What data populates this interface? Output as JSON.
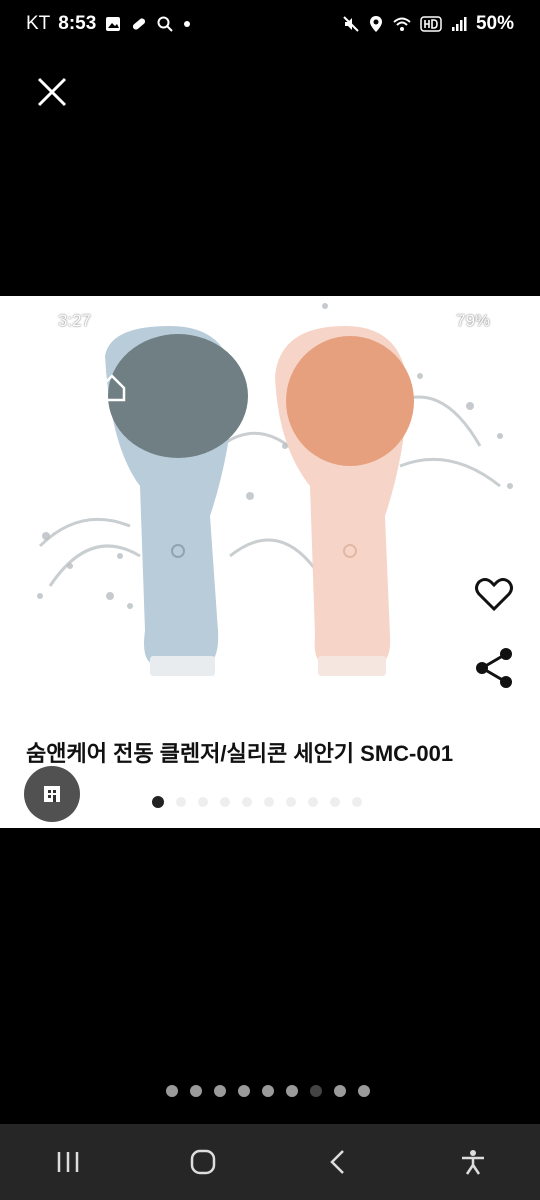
{
  "status_bar": {
    "carrier": "KT",
    "time": "8:53",
    "battery": "50%",
    "icons_left": [
      "gallery-icon",
      "pill-icon",
      "search-icon",
      "dot-icon"
    ],
    "icons_right": [
      "mute-icon",
      "location-icon",
      "wifi-icon",
      "hd-icon",
      "signal-icon"
    ]
  },
  "viewer": {
    "close_icon": "close-icon",
    "image_overlay": {
      "time": "3:27",
      "battery": "79%"
    },
    "caption": "숨앤케어 전동 클렌저/실리콘 세안기 SMC-001",
    "actions": {
      "heart_icon": "heart-icon",
      "share_icon": "share-icon",
      "store_icon": "store-icon"
    },
    "inner_dots": {
      "count": 10,
      "active_index": 0
    },
    "pager": {
      "count": 9,
      "active_index": 6
    }
  },
  "nav_bar": {
    "buttons": [
      "recent-apps",
      "home",
      "back",
      "accessibility"
    ]
  },
  "colors": {
    "background": "#000000",
    "nav_bar": "#262626",
    "device_blue": "#b9ccd9",
    "device_pink": "#f6d5c8",
    "head_gray": "#6f7f84",
    "head_peach": "#e6a07e"
  }
}
